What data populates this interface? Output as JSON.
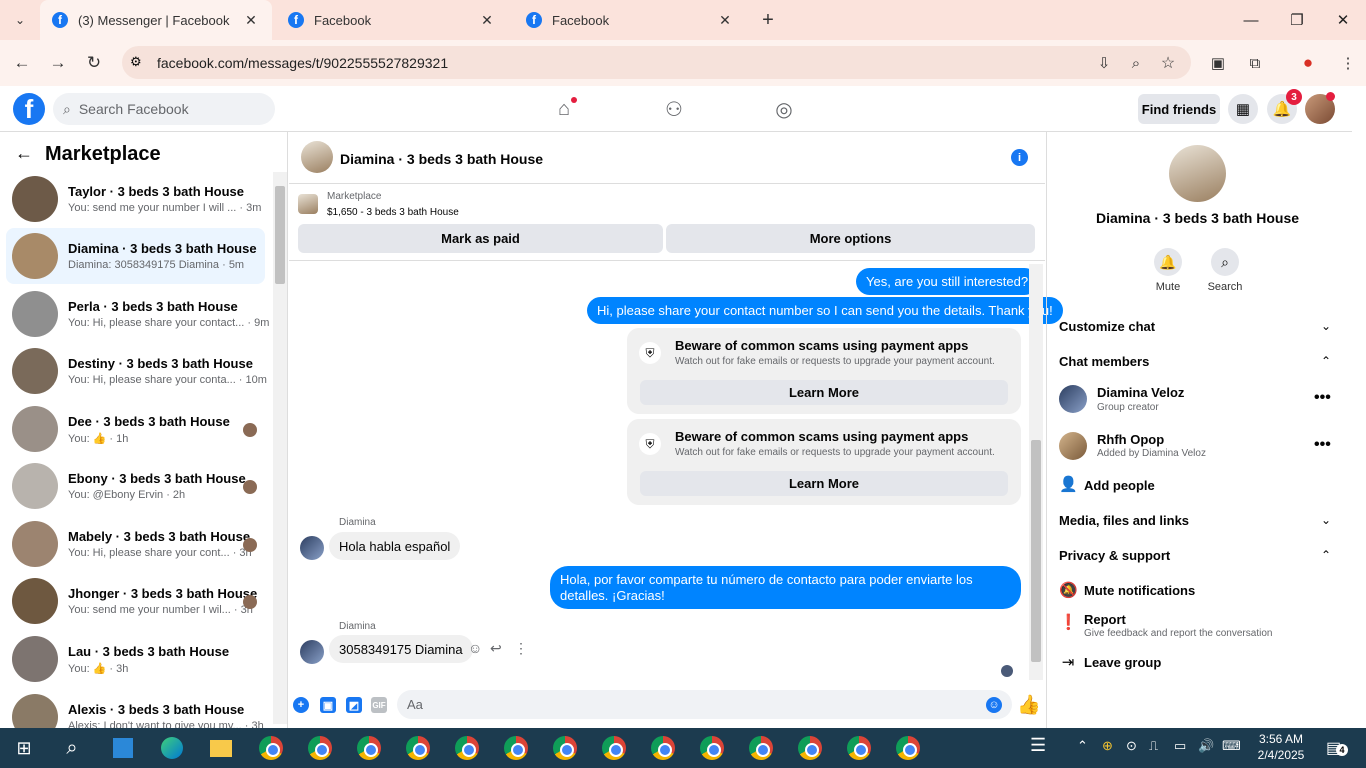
{
  "browser": {
    "tabs": [
      {
        "title": "(3) Messenger | Facebook"
      },
      {
        "title": "Facebook"
      },
      {
        "title": "Facebook"
      }
    ],
    "new_tab": "+",
    "url": "facebook.com/messages/t/9022555527829321"
  },
  "fb": {
    "logo": "f",
    "search_placeholder": "Search Facebook",
    "find_friends": "Find friends",
    "notif_count": "3"
  },
  "marketplace": {
    "title": "Marketplace",
    "conversations": [
      {
        "name": "Taylor · 3 beds 3 bath House",
        "preview": "You: send me your number I will ... · 3m",
        "avatar_color": "#6d5a48"
      },
      {
        "name": "Diamina · 3 beds 3 bath House",
        "preview": "Diamina: 3058349175 Diamina · 5m",
        "avatar_color": "#a88a68",
        "selected": true
      },
      {
        "name": "Perla · 3 beds 3 bath House",
        "preview": "You: Hi, please share your contact... · 9m",
        "avatar_color": "#8f8f8f"
      },
      {
        "name": "Destiny · 3 beds 3 bath House",
        "preview": "You: Hi, please share your conta... · 10m",
        "avatar_color": "#7a6a5a"
      },
      {
        "name": "Dee · 3 beds 3 bath House",
        "preview": "You: 👍 · 1h",
        "avatar_color": "#9a9088"
      },
      {
        "name": "Ebony · 3 beds 3 bath House",
        "preview": "You: @Ebony Ervin · 2h",
        "avatar_color": "#b8b3ad"
      },
      {
        "name": "Mabely · 3 beds 3 bath House",
        "preview": "You: Hi, please share your cont... · 3h",
        "avatar_color": "#9c8470"
      },
      {
        "name": "Jhonger · 3 beds 3 bath House",
        "preview": "You: send me your number I wil... · 3h",
        "avatar_color": "#6e5840"
      },
      {
        "name": "Lau · 3 beds 3 bath House",
        "preview": "You: 👍 · 3h",
        "avatar_color": "#7d7470"
      },
      {
        "name": "Alexis · 3 beds 3 bath House",
        "preview": "Alexis: I don't want to give you my... · 3h",
        "avatar_color": "#8a7a66"
      }
    ]
  },
  "chat": {
    "title": "Diamina · 3 beds 3 bath House",
    "info_icon": "i",
    "listing_label": "Marketplace",
    "listing_price": "$1,650 - 3 beds 3 bath House",
    "mark_paid": "Mark as paid",
    "more_options": "More options",
    "messages": {
      "m1": "Yes, are you still interested?",
      "m2": "Hi, please share your contact number so I can send you the details. Thank you!",
      "scam_title": "Beware of common scams using payment apps",
      "scam_text": "Watch out for fake emails or requests to upgrade your payment account.",
      "learn_more": "Learn More",
      "sender": "Diamina",
      "m3": "Hola habla español",
      "m4": "Hola, por favor comparte tu número de contacto para poder enviarte los detalles. ¡Gracias!",
      "m5": "3058349175 Diamina"
    },
    "input_placeholder": "Aa"
  },
  "info_panel": {
    "title": "Diamina · 3 beds 3 bath House",
    "mute": "Mute",
    "search": "Search",
    "customize": "Customize chat",
    "members_header": "Chat members",
    "members": [
      {
        "name": "Diamina Veloz",
        "sub": "Group creator"
      },
      {
        "name": "Rhfh Opop",
        "sub": "Added by Diamina Veloz"
      }
    ],
    "add_people": "Add people",
    "media": "Media, files and links",
    "privacy": "Privacy & support",
    "mute_notifications": "Mute notifications",
    "report": "Report",
    "report_sub": "Give feedback and report the conversation",
    "leave_group": "Leave group"
  },
  "taskbar": {
    "time": "3:56 AM",
    "date": "2/4/2025",
    "notif_count": "4"
  },
  "colors": {
    "accent": "#1877f2",
    "bubble_out": "#0084ff",
    "taskbar": "#1c3b4f"
  }
}
